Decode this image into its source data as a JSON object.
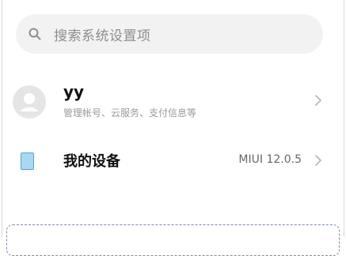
{
  "search": {
    "placeholder": "搜索系统设置项",
    "icon": "search-icon"
  },
  "account": {
    "name": "yy",
    "subtitle": "管理帐号、云服务、支付信息等",
    "avatar_icon": "avatar-placeholder-icon",
    "chevron_icon": "chevron-right-icon"
  },
  "device": {
    "label": "我的设备",
    "value": "MIUI 12.0.5",
    "icon": "device-icon",
    "chevron_icon": "chevron-right-icon"
  },
  "colors": {
    "accent": "#3ea9e8",
    "search_bg": "#f2f2f2",
    "muted_text": "#9a9a9a"
  }
}
